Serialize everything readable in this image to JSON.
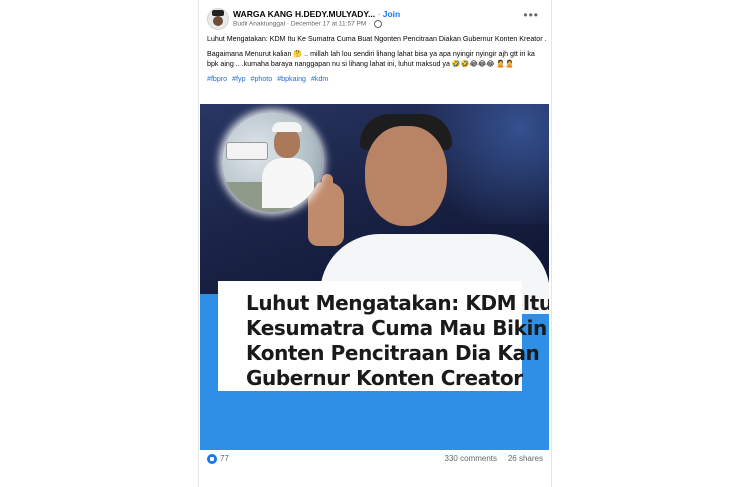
{
  "post": {
    "group_name": "WARGA KANG H.DEDY.MULYADY...",
    "separator": "·",
    "join_label": "Join",
    "author": "Budii Anaktunggal",
    "timestamp": "December 17 at 11:57 PM",
    "meta_sep": "·",
    "text_line1": "Luhut Mengatakan: KDM Itu Ke Sumatra Cuma Buat Ngonten Pencitraan Diakan Gubernur Konten Kreator .",
    "text_line2": "Bagaimana Menurut kalian 🤔 .. millah lah lou sendiri lihang lahat bisa ya apa nyingir nyingir ajh gtt iri ka bpk aing .. .kumaha baraya nanggapan nu si lihang lahat ini, luhut maksud ya 🤣🤣😂😂😂 🙎🙎",
    "hashtags": [
      "#fbpro",
      "#fyp",
      "#photo",
      "#bpkaing",
      "#kdm"
    ]
  },
  "media": {
    "caption_lines": [
      "Luhut Mengatakan: KDM Itu",
      "Kesumatra Cuma Mau Bikin",
      " Konten Pencitraan Dia Kan",
      "Gubernur Konten Creator"
    ]
  },
  "footer": {
    "likes": "77",
    "comments": "330 comments",
    "shares": "26 shares"
  },
  "colors": {
    "accent": "#1877f2",
    "hashtag": "#216fdb",
    "media_bottom": "#2f8ee6"
  }
}
